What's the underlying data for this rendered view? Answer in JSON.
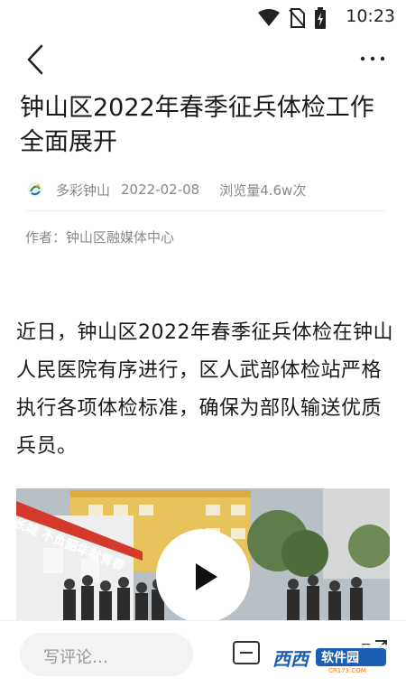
{
  "status_bar": {
    "time": "10:23"
  },
  "article": {
    "title": "钟山区2022年春季征兵体检工作全面展开",
    "source": "多彩钟山",
    "date": "2022-02-08",
    "views": "浏览量4.6w次",
    "author": "作者：钟山区融媒体中心",
    "body": "近日，钟山区2022年春季征兵体检在钟山人民医院有序进行，区人武部体检站严格执行各项体检标准，确保为部队输送优质兵员。"
  },
  "video": {
    "banner_text": "长城  不负韶华献青春"
  },
  "bottom_bar": {
    "comment_placeholder": "写评论…"
  },
  "watermark": {
    "brand": "西西",
    "tagline": "软件园",
    "site": "CR173.COM"
  },
  "colors": {
    "accent_red": "#d33a2c",
    "watermark_blue": "#1a5fb4",
    "watermark_orange": "#f07a1a"
  },
  "icons": [
    "wifi-icon",
    "no-sim-icon",
    "battery-icon",
    "back-arrow-icon",
    "more-icon",
    "source-logo-icon",
    "play-icon",
    "share-icon",
    "expand-icon"
  ]
}
